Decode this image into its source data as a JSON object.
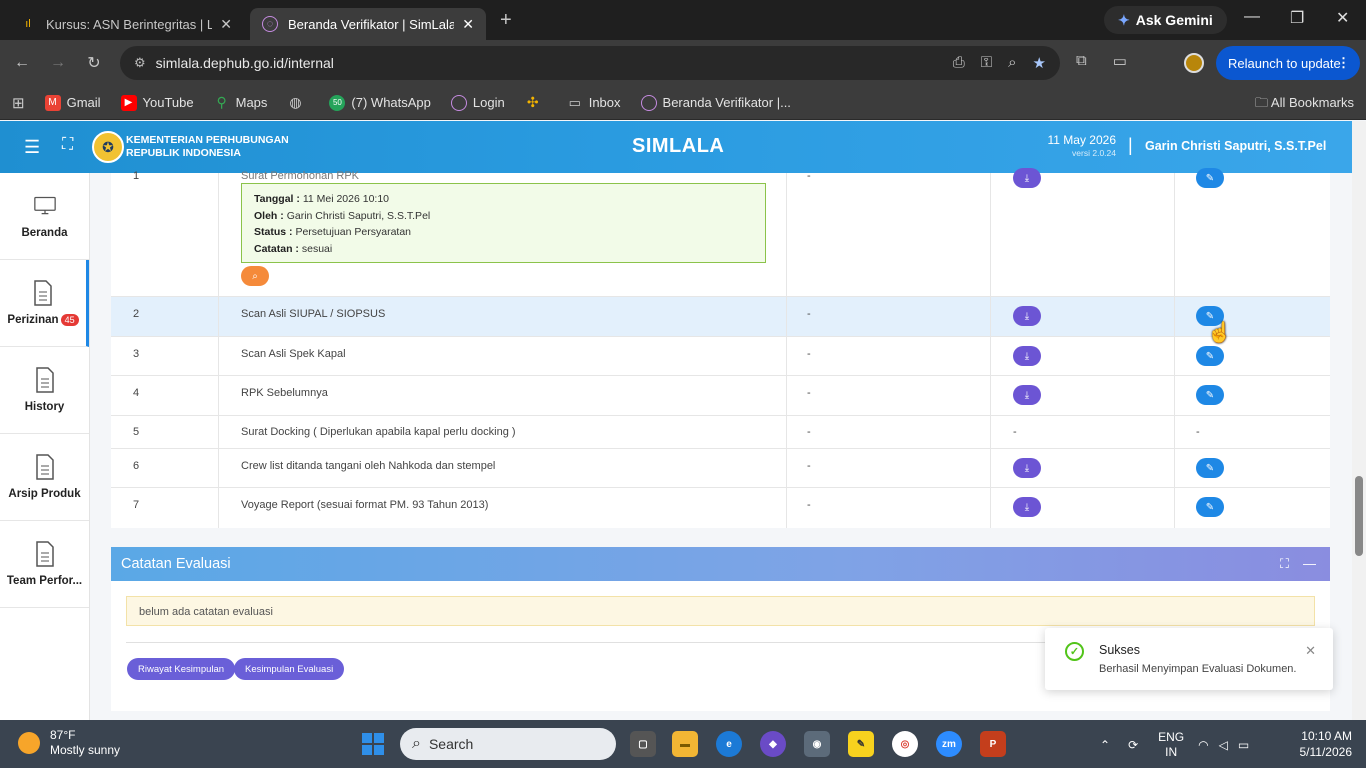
{
  "browser": {
    "tabs": [
      {
        "title": "Kursus: ASN Berintegritas | LMS",
        "active": false
      },
      {
        "title": "Beranda Verifikator | SimLala",
        "active": true
      }
    ],
    "gemini_label": "Ask Gemini",
    "url": "simlala.dephub.go.id/internal",
    "relaunch_label": "Relaunch to update",
    "bookmarks": [
      {
        "label": "Gmail",
        "icon": "gmail-icon",
        "color": "#ea4335"
      },
      {
        "label": "YouTube",
        "icon": "youtube-icon",
        "color": "#ff0000"
      },
      {
        "label": "Maps",
        "icon": "maps-icon",
        "color": "#34a853"
      },
      {
        "label": "",
        "icon": "globe-icon",
        "color": "#777777"
      },
      {
        "label": "(7) WhatsApp",
        "icon": "whatsapp-icon",
        "color": "#25d366",
        "badge": "50"
      },
      {
        "label": "Login",
        "icon": "login-icon",
        "color": "#a04ec2"
      },
      {
        "label": "",
        "icon": "pinwheel-icon",
        "color": "#f4b400"
      },
      {
        "label": "Inbox",
        "icon": "inbox-icon",
        "color": "#4285f4"
      },
      {
        "label": "Beranda Verifikator |...",
        "icon": "simlala-icon",
        "color": "#a04ec2"
      }
    ],
    "all_bookmarks": "All Bookmarks"
  },
  "header": {
    "ministry_line1": "KEMENTERIAN PERHUBUNGAN",
    "ministry_line2": "REPUBLIK INDONESIA",
    "app_title": "SIMLALA",
    "date": "11 May 2026",
    "version": "versi 2.0.24",
    "user": "Garin Christi Saputri, S.S.T.Pel"
  },
  "sidebar": {
    "items": [
      {
        "label": "Beranda"
      },
      {
        "label": "Perizinan",
        "badge": "45"
      },
      {
        "label": "History"
      },
      {
        "label": "Arsip Produk"
      },
      {
        "label": "Team Perfor..."
      }
    ]
  },
  "documents": {
    "rows": [
      {
        "no": "1",
        "name": "Surat Permohonan RPK",
        "col3": "-",
        "download": true,
        "edit": true,
        "note": {
          "tanggal_label": "Tanggal :",
          "tanggal": "11 Mei 2026 10:10",
          "oleh_label": "Oleh :",
          "oleh": "Garin Christi Saputri, S.S.T.Pel",
          "status_label": "Status :",
          "status": "Persetujuan Persyaratan",
          "catatan_label": "Catatan :",
          "catatan": "sesuai"
        }
      },
      {
        "no": "2",
        "name": "Scan Asli SIUPAL / SIOPSUS",
        "col3": "-",
        "download": true,
        "edit": true
      },
      {
        "no": "3",
        "name": "Scan Asli Spek Kapal",
        "col3": "-",
        "download": true,
        "edit": true
      },
      {
        "no": "4",
        "name": "RPK Sebelumnya",
        "col3": "-",
        "download": true,
        "edit": true
      },
      {
        "no": "5",
        "name": "Surat Docking ( Diperlukan apabila kapal perlu docking )",
        "col3": "-",
        "download": false,
        "edit": false,
        "col4": "-",
        "col5": "-"
      },
      {
        "no": "6",
        "name": "Crew list ditanda tangani oleh Nahkoda dan stempel",
        "col3": "-",
        "download": true,
        "edit": true
      },
      {
        "no": "7",
        "name": "Voyage Report (sesuai format PM. 93 Tahun 2013)",
        "col3": "-",
        "download": true,
        "edit": true
      }
    ]
  },
  "evaluation": {
    "title": "Catatan Evaluasi",
    "empty_note": "belum ada catatan evaluasi",
    "btn_history": "Riwayat Kesimpulan",
    "btn_conclusion": "Kesimpulan Evaluasi"
  },
  "toast": {
    "title": "Sukses",
    "message": "Berhasil Menyimpan Evaluasi Dokumen."
  },
  "taskbar": {
    "temp": "87°F",
    "weather": "Mostly sunny",
    "search_placeholder": "Search",
    "lang_top": "ENG",
    "lang_bottom": "IN",
    "time": "10:10 AM",
    "date": "5/11/2026"
  },
  "colors": {
    "header_blue": "#1f8fd1",
    "download_purple": "#6c55d4",
    "edit_blue": "#1e88e5",
    "zoom_orange": "#f58a3a",
    "success_green": "#52c41a"
  }
}
